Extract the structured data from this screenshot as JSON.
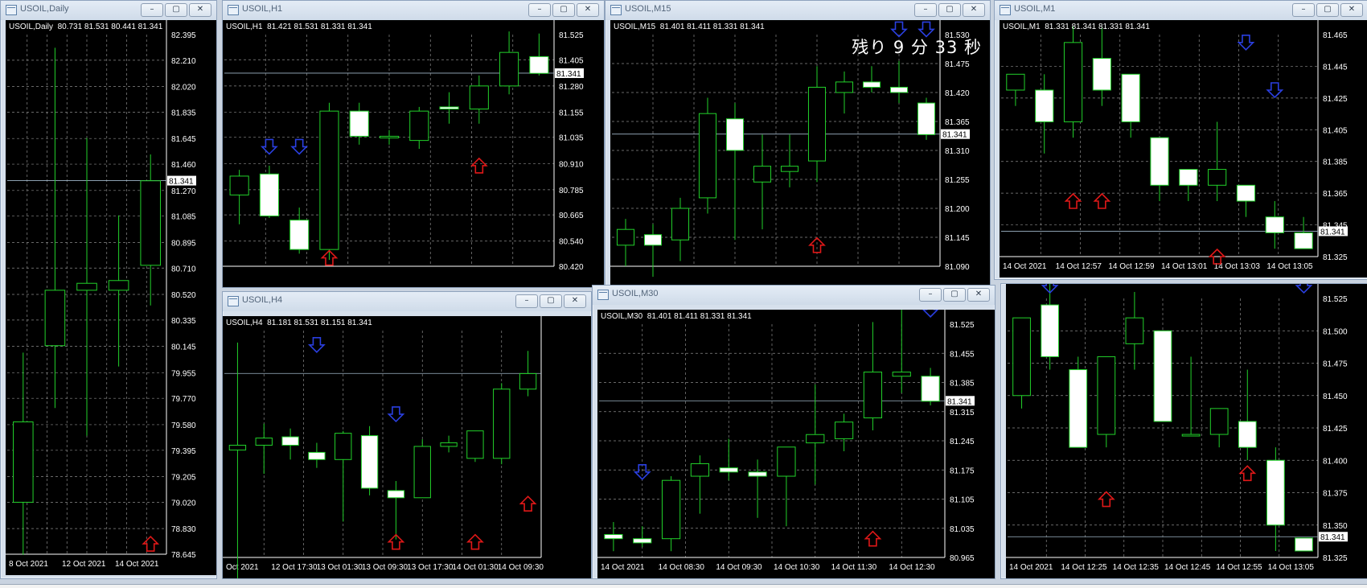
{
  "symbol": "USOIL",
  "countdown_text": "残り 9 分 33 秒",
  "window_buttons": [
    "–",
    "▢",
    "✕"
  ],
  "windows": [
    {
      "id": "daily",
      "title": "USOIL,Daily",
      "info": "USOIL,Daily  80.731 81.531 80.441 81.341",
      "price_labels": [
        "82.395",
        "82.210",
        "82.020",
        "81.835",
        "81.645",
        "81.460",
        "81.270",
        "81.085",
        "80.895",
        "80.710",
        "80.520",
        "80.335",
        "80.145",
        "79.955",
        "79.770",
        "79.580",
        "79.395",
        "79.205",
        "79.020",
        "78.830",
        "78.645"
      ],
      "time_labels": [
        "8 Oct 2021",
        "12 Oct 2021",
        "14 Oct 2021"
      ],
      "current_price": "81.341",
      "candles": [
        {
          "o": 79.02,
          "h": 80.1,
          "l": 78.64,
          "c": 79.6
        },
        {
          "o": 80.15,
          "h": 82.3,
          "l": 79.7,
          "c": 80.55
        },
        {
          "o": 80.55,
          "h": 81.65,
          "l": 79.5,
          "c": 80.6
        },
        {
          "o": 80.55,
          "h": 81.09,
          "l": 80.0,
          "c": 80.62
        },
        {
          "o": 80.73,
          "h": 81.53,
          "l": 80.44,
          "c": 81.34
        }
      ],
      "arrows": [
        {
          "i": 4,
          "dir": "up",
          "p": 78.72
        }
      ]
    },
    {
      "id": "h1",
      "title": "USOIL,H1",
      "info": "USOIL,H1  81.421 81.531 81.331 81.341",
      "price_labels": [
        "81.525",
        "81.405",
        "81.280",
        "81.155",
        "81.035",
        "80.910",
        "80.785",
        "80.665",
        "80.540",
        "80.420"
      ],
      "time_labels": [],
      "current_price": "81.341",
      "candles": [
        {
          "o": 80.76,
          "h": 80.88,
          "l": 80.62,
          "c": 80.85
        },
        {
          "o": 80.86,
          "h": 80.9,
          "l": 80.65,
          "c": 80.66
        },
        {
          "o": 80.64,
          "h": 80.7,
          "l": 80.48,
          "c": 80.5
        },
        {
          "o": 80.5,
          "h": 81.2,
          "l": 80.45,
          "c": 81.16
        },
        {
          "o": 81.16,
          "h": 81.2,
          "l": 81.0,
          "c": 81.04
        },
        {
          "o": 81.04,
          "h": 81.07,
          "l": 81.0,
          "c": 81.04
        },
        {
          "o": 81.02,
          "h": 81.18,
          "l": 80.98,
          "c": 81.16
        },
        {
          "o": 81.18,
          "h": 81.25,
          "l": 81.1,
          "c": 81.17
        },
        {
          "o": 81.17,
          "h": 81.33,
          "l": 81.1,
          "c": 81.28
        },
        {
          "o": 81.28,
          "h": 81.54,
          "l": 81.24,
          "c": 81.44
        },
        {
          "o": 81.42,
          "h": 81.53,
          "l": 81.33,
          "c": 81.34
        }
      ],
      "arrows": [
        {
          "i": 1,
          "dir": "down",
          "p": 80.99
        },
        {
          "i": 2,
          "dir": "down",
          "p": 80.99
        },
        {
          "i": 3,
          "dir": "up",
          "p": 80.46
        },
        {
          "i": 8,
          "dir": "up",
          "p": 80.9
        }
      ]
    },
    {
      "id": "m15",
      "title": "USOIL,M15",
      "info": "USOIL,M15  81.401 81.411 81.331 81.341",
      "price_labels": [
        "81.530",
        "81.475",
        "81.420",
        "81.365",
        "81.310",
        "81.255",
        "81.200",
        "81.145",
        "81.090"
      ],
      "time_labels": [],
      "current_price": "81.341",
      "candles": [
        {
          "o": 81.13,
          "h": 81.18,
          "l": 81.09,
          "c": 81.16
        },
        {
          "o": 81.15,
          "h": 81.17,
          "l": 81.07,
          "c": 81.13
        },
        {
          "o": 81.14,
          "h": 81.22,
          "l": 81.1,
          "c": 81.2
        },
        {
          "o": 81.22,
          "h": 81.41,
          "l": 81.19,
          "c": 81.38
        },
        {
          "o": 81.37,
          "h": 81.4,
          "l": 81.14,
          "c": 81.31
        },
        {
          "o": 81.25,
          "h": 81.34,
          "l": 81.16,
          "c": 81.28
        },
        {
          "o": 81.27,
          "h": 81.34,
          "l": 81.24,
          "c": 81.28
        },
        {
          "o": 81.29,
          "h": 81.47,
          "l": 81.25,
          "c": 81.43
        },
        {
          "o": 81.42,
          "h": 81.46,
          "l": 81.38,
          "c": 81.44
        },
        {
          "o": 81.44,
          "h": 81.47,
          "l": 81.42,
          "c": 81.43
        },
        {
          "o": 81.43,
          "h": 81.48,
          "l": 81.4,
          "c": 81.42
        },
        {
          "o": 81.4,
          "h": 81.41,
          "l": 81.33,
          "c": 81.34
        }
      ],
      "arrows": [
        {
          "i": 7,
          "dir": "up",
          "p": 81.13
        },
        {
          "i": 10,
          "dir": "down",
          "p": 81.54
        },
        {
          "i": 11,
          "dir": "down",
          "p": 81.54
        }
      ]
    },
    {
      "id": "m1top",
      "title": "USOIL,M1",
      "info": "USOIL,M1  81.331 81.341 81.331 81.341",
      "price_labels": [
        "81.465",
        "81.445",
        "81.425",
        "81.405",
        "81.385",
        "81.365",
        "81.345",
        "81.325"
      ],
      "time_labels": [
        "14 Oct 2021",
        "14 Oct 12:57",
        "14 Oct 12:59",
        "14 Oct 13:01",
        "14 Oct 13:03",
        "14 Oct 13:05"
      ],
      "current_price": "81.341",
      "candles": [
        {
          "o": 81.43,
          "h": 81.44,
          "l": 81.42,
          "c": 81.44
        },
        {
          "o": 81.43,
          "h": 81.44,
          "l": 81.39,
          "c": 81.41
        },
        {
          "o": 81.41,
          "h": 81.47,
          "l": 81.4,
          "c": 81.46
        },
        {
          "o": 81.45,
          "h": 81.47,
          "l": 81.42,
          "c": 81.43
        },
        {
          "o": 81.44,
          "h": 81.44,
          "l": 81.4,
          "c": 81.41
        },
        {
          "o": 81.4,
          "h": 81.4,
          "l": 81.36,
          "c": 81.37
        },
        {
          "o": 81.38,
          "h": 81.38,
          "l": 81.36,
          "c": 81.37
        },
        {
          "o": 81.37,
          "h": 81.41,
          "l": 81.36,
          "c": 81.38
        },
        {
          "o": 81.37,
          "h": 81.37,
          "l": 81.35,
          "c": 81.36
        },
        {
          "o": 81.35,
          "h": 81.36,
          "l": 81.33,
          "c": 81.34
        },
        {
          "o": 81.34,
          "h": 81.35,
          "l": 81.33,
          "c": 81.33
        }
      ],
      "arrows": [
        {
          "i": 2,
          "dir": "up",
          "p": 81.36
        },
        {
          "i": 3,
          "dir": "up",
          "p": 81.36
        },
        {
          "i": 7,
          "dir": "up",
          "p": 81.325
        },
        {
          "i": 8,
          "dir": "down",
          "p": 81.46
        },
        {
          "i": 9,
          "dir": "down",
          "p": 81.43
        }
      ]
    },
    {
      "id": "h4",
      "title": "USOIL,H4",
      "info": "USOIL,H4  81.181 81.531 81.151 81.341",
      "price_labels": [],
      "time_labels": [
        "Oct 2021",
        "12 Oct 17:30",
        "13 Oct 01:30",
        "13 Oct 09:30",
        "13 Oct 17:30",
        "14 Oct 01:30",
        "14 Oct 09:30"
      ],
      "current_price": "",
      "candles": [
        {
          "o": 80.7,
          "h": 81.6,
          "l": 79.2,
          "c": 80.74
        },
        {
          "o": 80.74,
          "h": 80.92,
          "l": 80.5,
          "c": 80.8
        },
        {
          "o": 80.81,
          "h": 80.88,
          "l": 80.62,
          "c": 80.74
        },
        {
          "o": 80.68,
          "h": 80.76,
          "l": 80.55,
          "c": 80.62
        },
        {
          "o": 80.62,
          "h": 80.86,
          "l": 80.1,
          "c": 80.84
        },
        {
          "o": 80.82,
          "h": 80.9,
          "l": 80.32,
          "c": 80.38
        },
        {
          "o": 80.36,
          "h": 80.44,
          "l": 79.95,
          "c": 80.3
        },
        {
          "o": 80.3,
          "h": 80.79,
          "l": 80.3,
          "c": 80.73
        },
        {
          "o": 80.73,
          "h": 80.82,
          "l": 80.68,
          "c": 80.76
        },
        {
          "o": 80.63,
          "h": 80.86,
          "l": 80.6,
          "c": 80.86
        },
        {
          "o": 80.63,
          "h": 81.26,
          "l": 80.58,
          "c": 81.21
        },
        {
          "o": 81.21,
          "h": 81.53,
          "l": 81.15,
          "c": 81.34
        }
      ],
      "arrows": [
        {
          "i": 3,
          "dir": "down",
          "p": 81.58
        },
        {
          "i": 6,
          "dir": "down",
          "p": 81.0
        },
        {
          "i": 6,
          "dir": "up",
          "p": 79.93
        },
        {
          "i": 9,
          "dir": "up",
          "p": 79.93
        },
        {
          "i": 11,
          "dir": "up",
          "p": 80.25
        }
      ]
    },
    {
      "id": "m30",
      "title": "USOIL,M30",
      "info": "USOIL,M30  81.401 81.411 81.331 81.341",
      "price_labels": [
        "81.525",
        "81.455",
        "81.385",
        "81.315",
        "81.245",
        "81.175",
        "81.105",
        "81.035",
        "80.965"
      ],
      "time_labels": [
        "14 Oct 2021",
        "14 Oct 08:30",
        "14 Oct 09:30",
        "14 Oct 10:30",
        "14 Oct 11:30",
        "14 Oct 12:30"
      ],
      "current_price": "81.341",
      "candles": [
        {
          "o": 81.02,
          "h": 81.05,
          "l": 80.98,
          "c": 81.01
        },
        {
          "o": 81.01,
          "h": 81.04,
          "l": 80.99,
          "c": 81.0
        },
        {
          "o": 81.01,
          "h": 81.16,
          "l": 80.98,
          "c": 81.15
        },
        {
          "o": 81.16,
          "h": 81.21,
          "l": 81.07,
          "c": 81.19
        },
        {
          "o": 81.18,
          "h": 81.25,
          "l": 81.15,
          "c": 81.17
        },
        {
          "o": 81.17,
          "h": 81.2,
          "l": 81.06,
          "c": 81.16
        },
        {
          "o": 81.16,
          "h": 81.23,
          "l": 81.04,
          "c": 81.23
        },
        {
          "o": 81.24,
          "h": 81.38,
          "l": 81.14,
          "c": 81.26
        },
        {
          "o": 81.25,
          "h": 81.31,
          "l": 81.22,
          "c": 81.29
        },
        {
          "o": 81.3,
          "h": 81.53,
          "l": 81.27,
          "c": 81.41
        },
        {
          "o": 81.4,
          "h": 81.56,
          "l": 81.36,
          "c": 81.41
        },
        {
          "o": 81.4,
          "h": 81.42,
          "l": 81.33,
          "c": 81.34
        }
      ],
      "arrows": [
        {
          "i": 1,
          "dir": "down",
          "p": 81.17
        },
        {
          "i": 9,
          "dir": "up",
          "p": 81.01
        },
        {
          "i": 11,
          "dir": "down",
          "p": 81.56
        }
      ]
    },
    {
      "id": "m1bottom",
      "title": "",
      "info": "",
      "price_labels": [
        "81.525",
        "81.500",
        "81.475",
        "81.450",
        "81.425",
        "81.400",
        "81.375",
        "81.350",
        "81.325"
      ],
      "time_labels": [
        "14 Oct 2021",
        "14 Oct 12:25",
        "14 Oct 12:35",
        "14 Oct 12:45",
        "14 Oct 12:55",
        "14 Oct 13:05"
      ],
      "current_price": "81.341",
      "candles": [
        {
          "o": 81.45,
          "h": 81.51,
          "l": 81.44,
          "c": 81.51
        },
        {
          "o": 81.52,
          "h": 81.54,
          "l": 81.47,
          "c": 81.48
        },
        {
          "o": 81.47,
          "h": 81.48,
          "l": 81.41,
          "c": 81.41
        },
        {
          "o": 81.42,
          "h": 81.48,
          "l": 81.41,
          "c": 81.48
        },
        {
          "o": 81.49,
          "h": 81.53,
          "l": 81.47,
          "c": 81.51
        },
        {
          "o": 81.5,
          "h": 81.5,
          "l": 81.43,
          "c": 81.43
        },
        {
          "o": 81.42,
          "h": 81.48,
          "l": 81.42,
          "c": 81.42
        },
        {
          "o": 81.42,
          "h": 81.44,
          "l": 81.41,
          "c": 81.44
        },
        {
          "o": 81.43,
          "h": 81.47,
          "l": 81.4,
          "c": 81.41
        },
        {
          "o": 81.4,
          "h": 81.41,
          "l": 81.33,
          "c": 81.35
        },
        {
          "o": 81.34,
          "h": 81.34,
          "l": 81.33,
          "c": 81.33
        }
      ],
      "arrows": [
        {
          "i": 1,
          "dir": "down",
          "p": 81.535
        },
        {
          "i": 3,
          "dir": "up",
          "p": 81.37
        },
        {
          "i": 8,
          "dir": "up",
          "p": 81.39
        },
        {
          "i": 10,
          "dir": "down",
          "p": 81.535
        }
      ]
    }
  ]
}
